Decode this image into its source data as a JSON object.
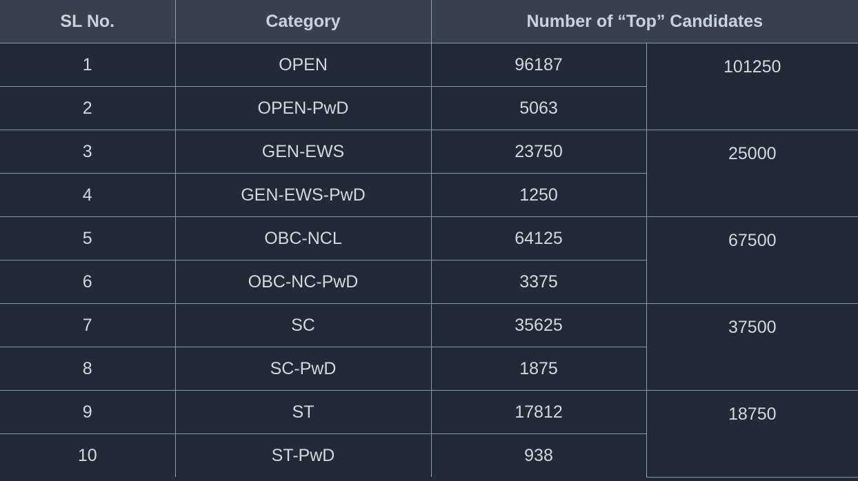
{
  "headers": {
    "sl_no": "SL No.",
    "category": "Category",
    "count": "Number of “Top” Candidates"
  },
  "rows": [
    {
      "sl": "1",
      "category": "OPEN",
      "count": "96187"
    },
    {
      "sl": "2",
      "category": "OPEN-PwD",
      "count": "5063"
    },
    {
      "sl": "3",
      "category": "GEN-EWS",
      "count": "23750"
    },
    {
      "sl": "4",
      "category": "GEN-EWS-PwD",
      "count": "1250"
    },
    {
      "sl": "5",
      "category": "OBC-NCL",
      "count": "64125"
    },
    {
      "sl": "6",
      "category": "OBC-NC-PwD",
      "count": "3375"
    },
    {
      "sl": "7",
      "category": "SC",
      "count": "35625"
    },
    {
      "sl": "8",
      "category": "SC-PwD",
      "count": "1875"
    },
    {
      "sl": "9",
      "category": "ST",
      "count": "17812"
    },
    {
      "sl": "10",
      "category": "ST-PwD",
      "count": "938"
    }
  ],
  "totals": [
    "101250",
    "25000",
    "67500",
    "37500",
    "18750"
  ],
  "colors": {
    "background": "#232a34",
    "header_background": "#3a414b",
    "border": "#8f98a3",
    "text": "#d3d8de"
  }
}
